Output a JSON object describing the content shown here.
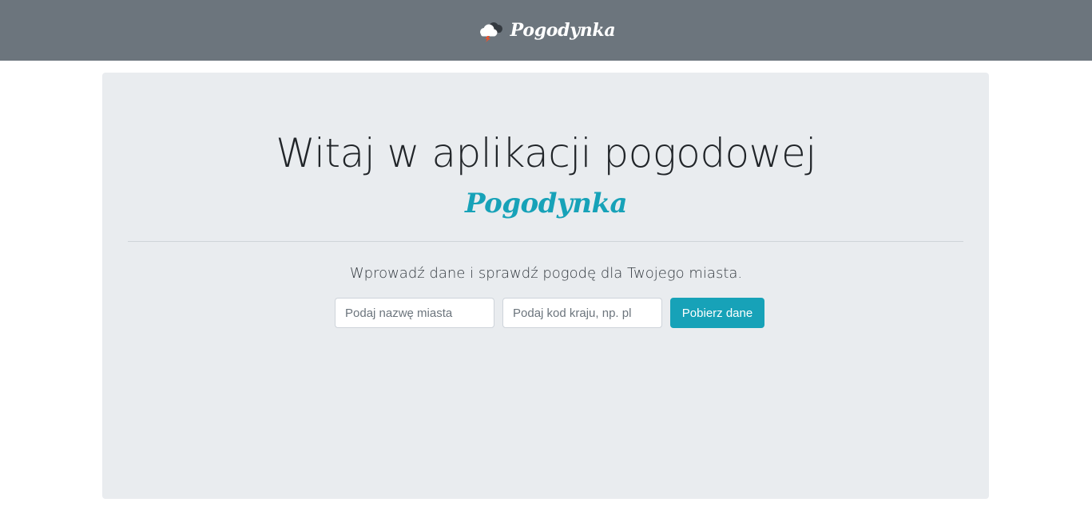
{
  "navbar": {
    "brand_icon": "storm-cloud-icon",
    "brand_text": "Pogodynka",
    "background": "#6c757d"
  },
  "hero": {
    "title": "Witaj w aplikacji pogodowej",
    "app_name": "Pogodynka",
    "app_name_color": "#17a2b8",
    "lead": "Wprowadź dane i sprawdź pogodę dla Twojego miasta.",
    "background": "#e9ecef"
  },
  "form": {
    "city_placeholder": "Podaj nazwę miasta",
    "city_value": "",
    "country_placeholder": "Podaj kod kraju, np. pl",
    "country_value": "",
    "submit_label": "Pobierz dane",
    "accent": "#17a2b8"
  }
}
